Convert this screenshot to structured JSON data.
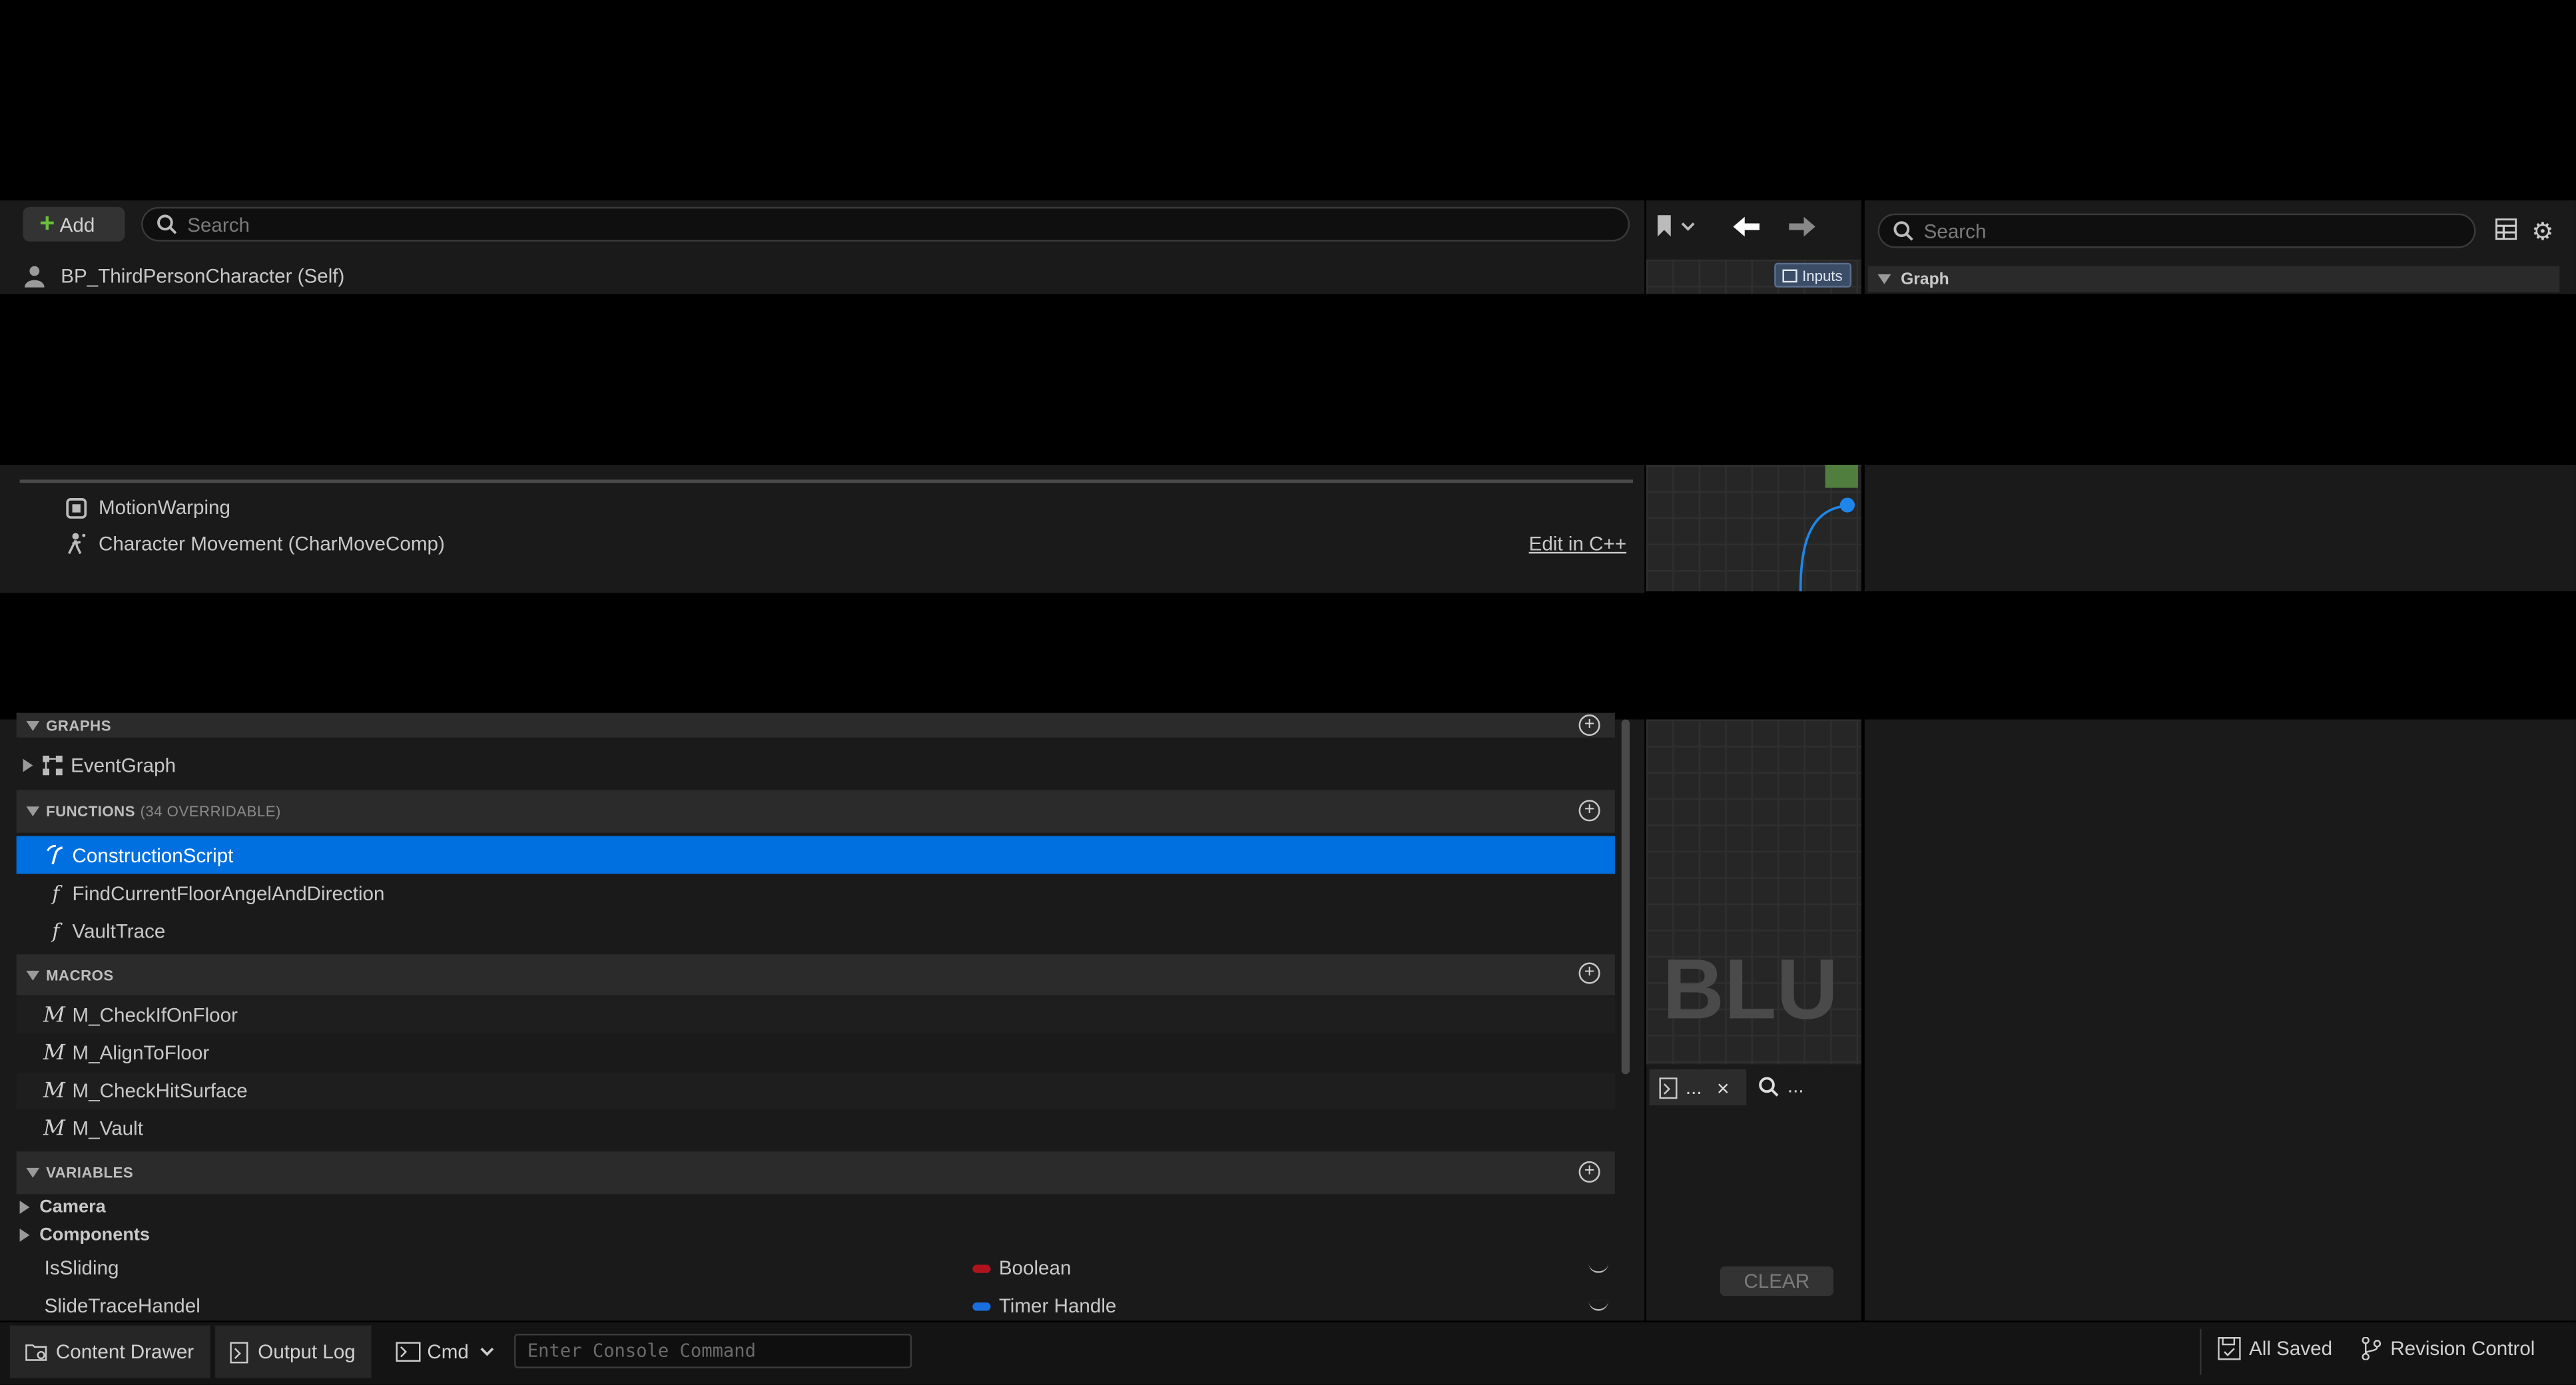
{
  "components": {
    "add_label": "Add",
    "search_placeholder": "Search",
    "self_item": "BP_ThirdPersonCharacter (Self)",
    "motion_warping": "MotionWarping",
    "char_movement": "Character Movement (CharMoveComp)",
    "edit_cpp": "Edit in C++"
  },
  "my_blueprint": {
    "graphs_header": "GRAPHS",
    "event_graph": "EventGraph",
    "functions_header": "FUNCTIONS",
    "functions_note": "(34 OVERRIDABLE)",
    "functions": [
      "ConstructionScript",
      "FindCurrentFloorAngelAndDirection",
      "VaultTrace"
    ],
    "macros_header": "MACROS",
    "macros": [
      "M_CheckIfOnFloor",
      "M_AlignToFloor",
      "M_CheckHitSurface",
      "M_Vault"
    ],
    "variables_header": "VARIABLES",
    "var_categories": [
      "Camera",
      "Components"
    ],
    "variables": [
      {
        "name": "IsSliding",
        "type": "Boolean",
        "color": "#b0141a"
      },
      {
        "name": "SlideTraceHandel",
        "type": "Timer Handle",
        "color": "#1a6fe0"
      }
    ]
  },
  "graph": {
    "inputs_badge": "Inputs",
    "watermark": "BLUE",
    "find_ellipsis": "...",
    "clear_label": "CLEAR",
    "tab_ellipsis": "..."
  },
  "details": {
    "search_placeholder": "Search",
    "graph_section": "Graph"
  },
  "statusbar": {
    "content_drawer": "Content Drawer",
    "output_log": "Output Log",
    "cmd": "Cmd",
    "console_placeholder": "Enter Console Command",
    "all_saved": "All Saved",
    "revision_control": "Revision Control"
  },
  "colors": {
    "selection": "#0070e0",
    "accent_green": "#6bbf3a"
  }
}
